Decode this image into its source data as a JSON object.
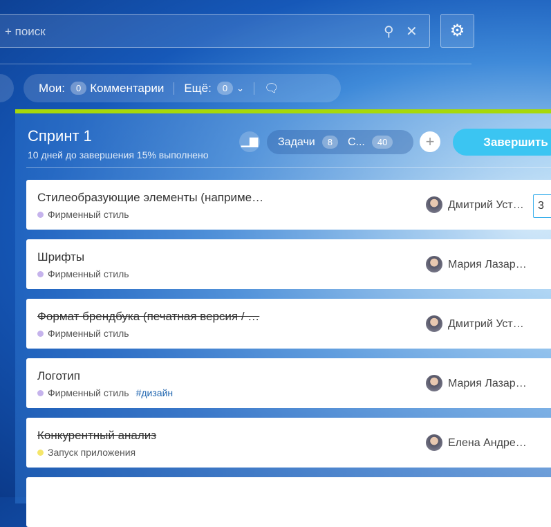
{
  "search": {
    "placeholder": "+ поиск",
    "search_icon": "magnifier",
    "clear_icon": "x"
  },
  "settings_icon": "gear",
  "filters": {
    "mine_label": "Мои:",
    "comments_count": "0",
    "comments_label": "Комментарии",
    "more_label": "Ещё:",
    "more_count": "0"
  },
  "sprint": {
    "title": "Спринт 1",
    "subtitle": "10 дней до завершения 15% выполнено",
    "tabs": [
      {
        "label": "Задачи",
        "count": "8"
      },
      {
        "label": "С...",
        "count": "40"
      }
    ],
    "plus": "+",
    "finish_label": "Завершить",
    "accent": "#a7d80a"
  },
  "tasks": [
    {
      "name": "Стилеобразующие элементы (наприме…",
      "tag": "Фирменный стиль",
      "tag_color": "#c5b3ec",
      "user": "Дмитрий Уст…",
      "done": false,
      "estimate": "3"
    },
    {
      "name": "Шрифты",
      "tag": "Фирменный стиль",
      "tag_color": "#c5b3ec",
      "user": "Мария Лазар…",
      "done": false
    },
    {
      "name": "Формат брендбука (печатная версия / …",
      "tag": "Фирменный стиль",
      "tag_color": "#c5b3ec",
      "user": "Дмитрий Уст…",
      "done": true
    },
    {
      "name": "Логотип",
      "tag": "Фирменный стиль",
      "tag_color": "#c5b3ec",
      "hashtag": "#дизайн",
      "user": "Мария Лазар…",
      "done": false
    },
    {
      "name": "Конкурентный анализ",
      "tag": "Запуск приложения",
      "tag_color": "#f5e66a",
      "user": "Елена Андре…",
      "done": true
    }
  ]
}
